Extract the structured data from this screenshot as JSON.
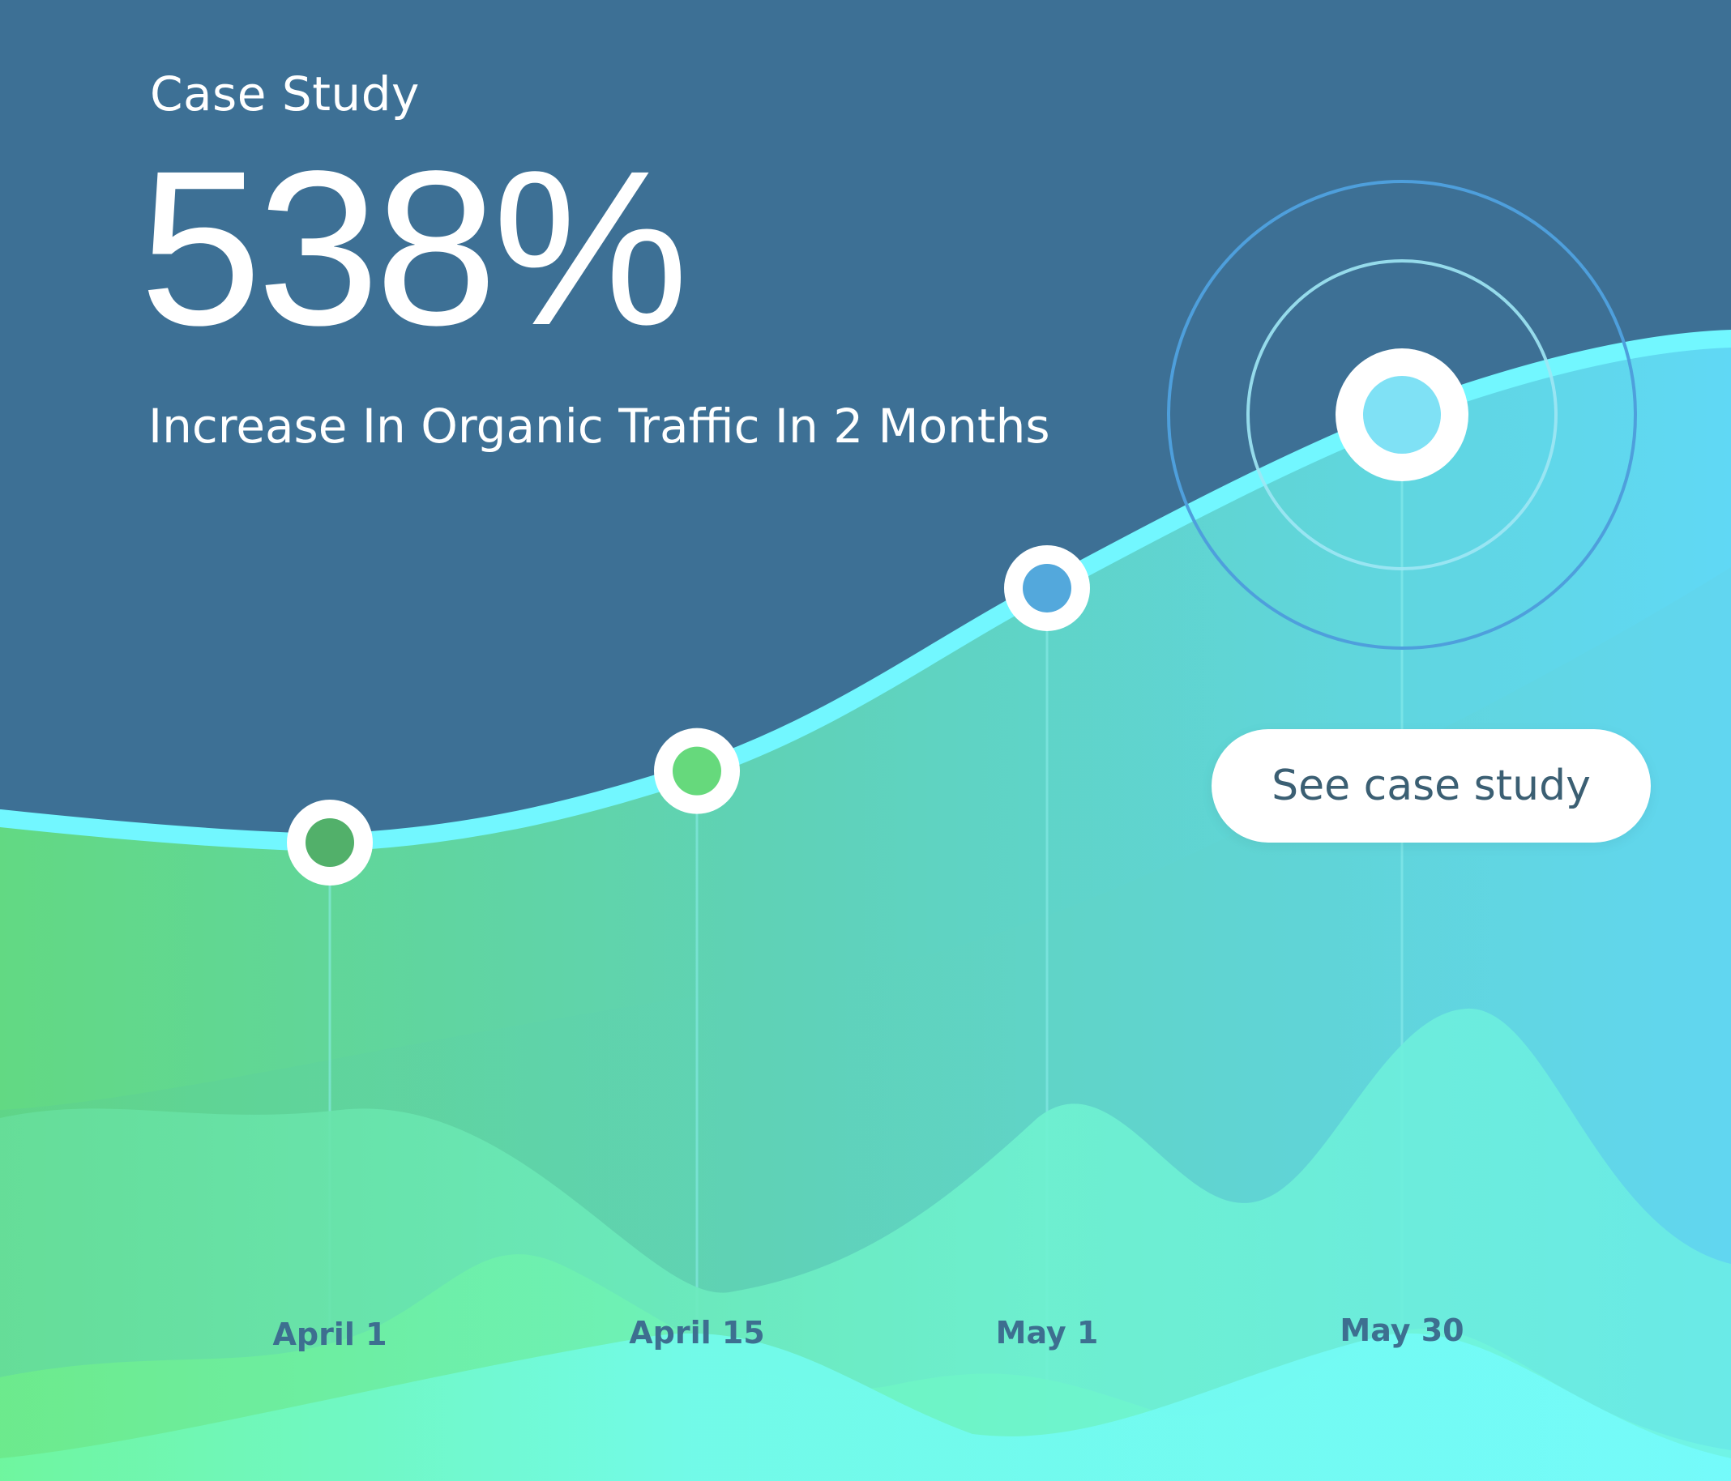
{
  "header": {
    "eyebrow": "Case Study",
    "stat": "538%",
    "subtitle": "Increase In Organic Traffic In 2 Months"
  },
  "cta": {
    "label": "See case study"
  },
  "colors": {
    "background": "#3d7095",
    "line": "#72f7ff",
    "point_april_1": "#52b06a",
    "point_april_15": "#66d97c",
    "point_may_1": "#53a8dc",
    "point_may_30": "#7fe1f5",
    "area_start": "#5fd17f",
    "area_end": "#5fd6f2"
  },
  "chart_data": {
    "type": "area",
    "x": [
      "April 1",
      "April 15",
      "May 1",
      "May 30"
    ],
    "series": [
      {
        "values": [
          100,
          190,
          420,
          638
        ]
      }
    ],
    "highlight": "May 30",
    "grid": false,
    "legend": "none"
  }
}
